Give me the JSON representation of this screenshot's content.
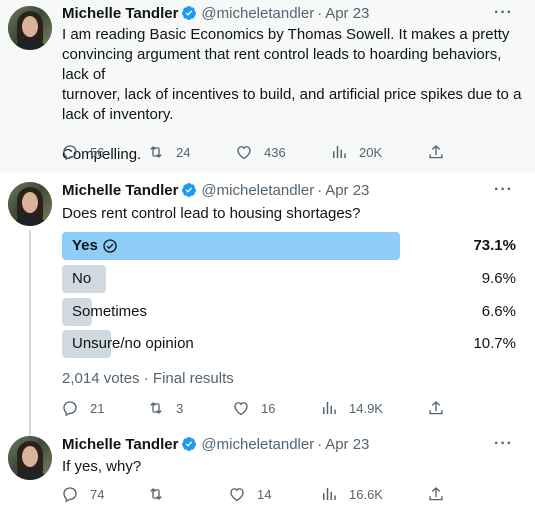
{
  "author": {
    "name": "Michelle Tandler",
    "handle": "@micheletandler",
    "verified": true
  },
  "separator": "·",
  "more_label": "···",
  "tweets": [
    {
      "date": "Apr 23",
      "text_lines": [
        "I am reading Basic Economics by Thomas Sowell. It makes a pretty",
        "convincing argument that rent control leads to hoarding behaviors, lack of",
        "turnover, lack of incentives to build, and artificial price spikes due to a",
        "lack of inventory.",
        "",
        "Compelling."
      ],
      "stats": {
        "replies": "56",
        "retweets": "24",
        "likes": "436",
        "views": "20K"
      }
    },
    {
      "date": "Apr 23",
      "text": "Does rent control lead to housing shortages?",
      "poll": {
        "options": [
          {
            "label": "Yes",
            "percent_text": "73.1%",
            "share": 0.731,
            "winner": true
          },
          {
            "label": "No",
            "percent_text": "9.6%",
            "share": 0.096,
            "winner": false
          },
          {
            "label": "Sometimes",
            "percent_text": "6.6%",
            "share": 0.066,
            "winner": false
          },
          {
            "label": "Unsure/no opinion",
            "percent_text": "10.7%",
            "share": 0.107,
            "winner": false
          }
        ],
        "votes": "2,014 votes",
        "status": "Final results"
      },
      "stats": {
        "replies": "21",
        "retweets": "3",
        "likes": "16",
        "views": "14.9K"
      }
    },
    {
      "date": "Apr 23",
      "text": "If yes, why?",
      "stats": {
        "replies": "74",
        "retweets": "",
        "likes": "14",
        "views": "16.6K"
      }
    }
  ],
  "colors": {
    "accent": "#1d9bf0",
    "poll_winner": "#8ecdf8",
    "poll_other": "#cfd9de",
    "muted_text": "#536471",
    "highlight_bg": "#f7f9f9"
  },
  "icons": {
    "reply": "speech-bubble-icon",
    "retweet": "retweet-arrows-icon",
    "like": "heart-outline-icon",
    "views": "bar-chart-icon",
    "share": "upload-arrow-icon",
    "verified": "verified-badge-icon",
    "more": "ellipsis-icon",
    "check": "check-circle-icon"
  }
}
